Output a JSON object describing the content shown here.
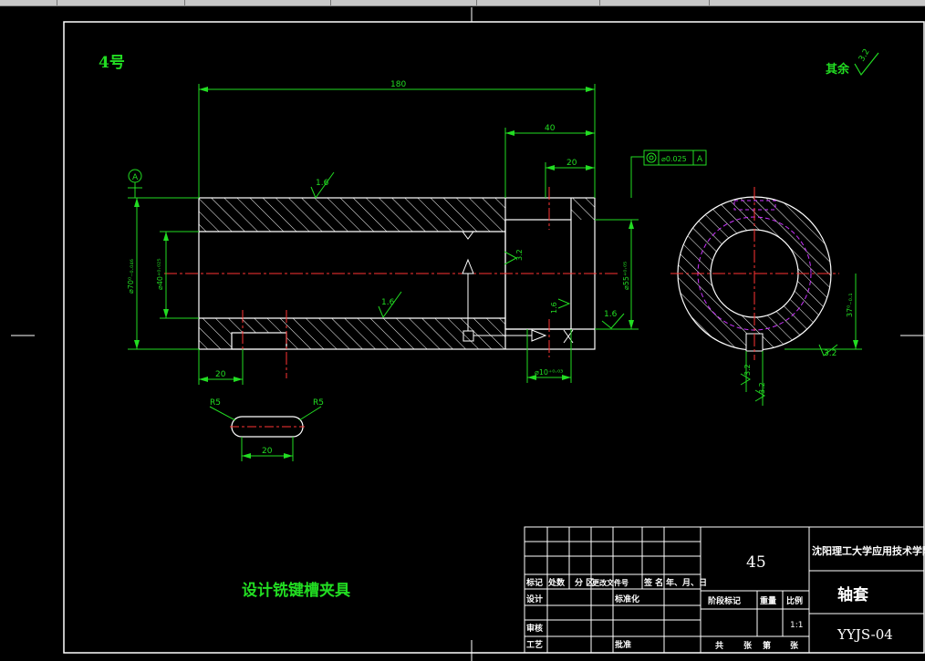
{
  "sheet_number": "4号",
  "roughness_note": {
    "label": "其余",
    "value": "3.2"
  },
  "title_caption": "设计铣键槽夹具",
  "datum_label": "A",
  "tolerance_frame": {
    "value": "⌀0.025",
    "datum": "A"
  },
  "dimensions": {
    "total_length": "180",
    "counterbore_length": "40",
    "slot_offset_right": "20",
    "left_offset": "20",
    "slot_length": "20",
    "outer_diameter": "⌀70⁰₋₀.₀₄₆",
    "bore_diameter": "⌀40⁺⁰·⁰²⁵",
    "counterbore_diameter": "⌀55⁺⁰·⁰⁵",
    "pin_hole": "⌀10⁺⁰·⁰³",
    "key_depth": "37⁰₋₀.₁",
    "radius_left": "R5",
    "radius_right": "R5"
  },
  "roughness_marks": [
    "1.6",
    "1.6",
    "3.2",
    "1.6",
    "1.6",
    "3.2",
    "3.2",
    "3.2"
  ],
  "title_block": {
    "material": "45",
    "school": "沈阳理工大学应用技术学院",
    "part_name": "轴套",
    "drawing_no": "YYJS-04",
    "scale": "1:1",
    "headers": [
      "标记",
      "处数",
      "分 区",
      "更改文件号",
      "签 名",
      "年、月、日"
    ],
    "design": "设计",
    "standardize": "标准化",
    "review": "审核",
    "process": "工艺",
    "approve": "批准",
    "stage": "阶段标记",
    "weight": "重量",
    "ratio": "比例",
    "total": "共",
    "sheets": "张",
    "sheet_no": "第",
    "sheet_unit": "张"
  }
}
